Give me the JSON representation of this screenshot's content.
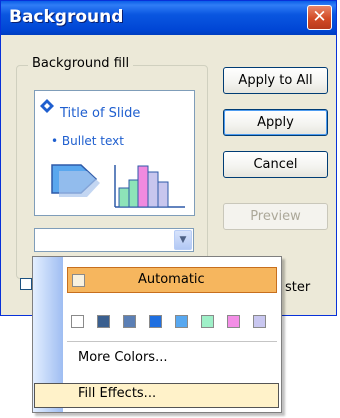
{
  "dialog": {
    "title": "Background",
    "group_label": "Background fill",
    "preview": {
      "slide_title": "Title of Slide",
      "bullet_text": "• Bullet text"
    },
    "buttons": {
      "apply_to_all": "Apply to All",
      "apply": "Apply",
      "cancel": "Cancel",
      "preview": "Preview"
    },
    "checkbox_partial_label": "ster"
  },
  "menu": {
    "automatic": "Automatic",
    "swatch_colors": [
      "#ffffff",
      "#3a5f8f",
      "#5b7fb5",
      "#1f6fe0",
      "#58a8f0",
      "#9ff0c8",
      "#f38ee6",
      "#c9c7f0"
    ],
    "more_colors": "More Colors...",
    "fill_effects": "Fill Effects..."
  }
}
